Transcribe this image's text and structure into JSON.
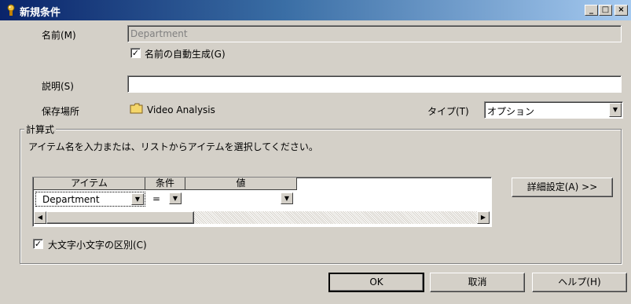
{
  "window": {
    "title": "新規条件",
    "controls": [
      "_",
      "□",
      "×"
    ]
  },
  "form": {
    "name_label": "名前(M)",
    "name_value": "Department",
    "auto_name_label": "名前の自動生成(G)",
    "auto_name_checked": true,
    "description_label": "説明(S)",
    "description_value": "",
    "location_label": "保存場所",
    "location_value": "Video Analysis",
    "type_label": "タイプ(T)",
    "type_value": "オプション"
  },
  "formula": {
    "group_label": "計算式",
    "instruction": "アイテム名を入力または、リストからアイテムを選択してください。",
    "columns": [
      "アイテム",
      "条件",
      "値"
    ],
    "rows": [
      {
        "item": "Department",
        "condition": "=",
        "value": ""
      }
    ],
    "advanced_button": "詳細設定(A) >>",
    "case_sensitive_label": "大文字小文字の区別(C)",
    "case_sensitive_checked": true
  },
  "buttons": {
    "ok": "OK",
    "cancel": "取消",
    "help": "ヘルプ(H)"
  },
  "icons": {
    "title": "wizard-icon",
    "folder": "folder-icon"
  },
  "colors": {
    "titlebar_start": "#0a246a",
    "titlebar_end": "#a6caf0",
    "face": "#d4d0c8"
  }
}
